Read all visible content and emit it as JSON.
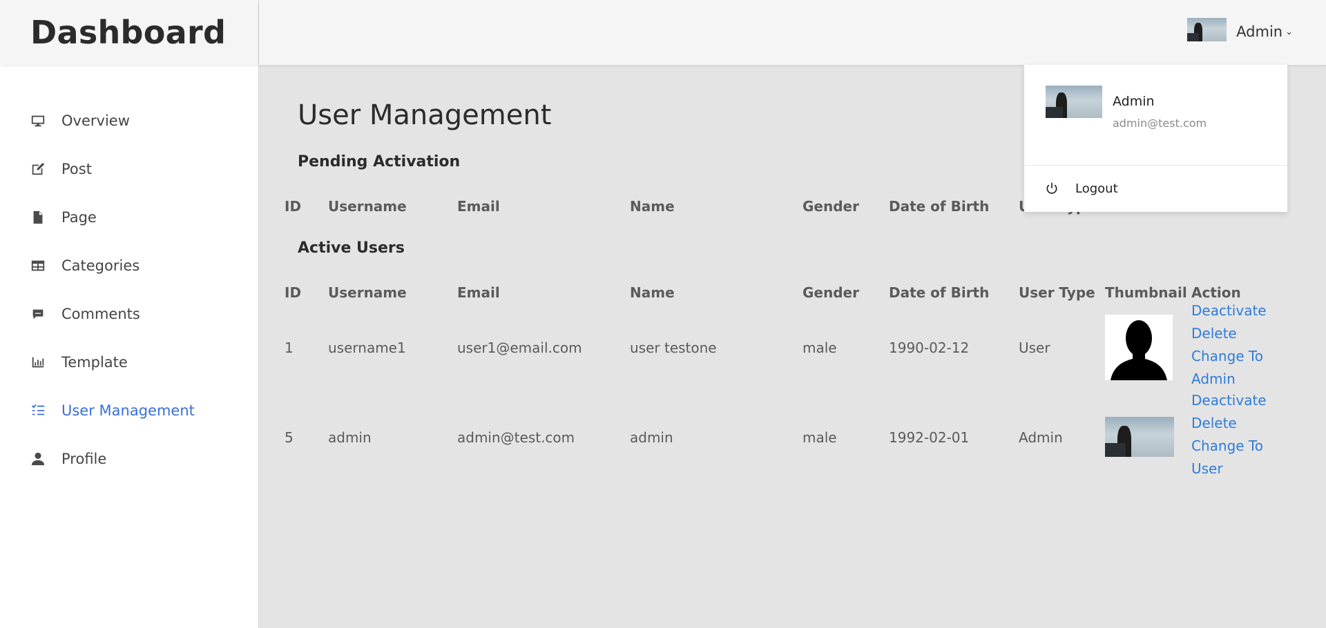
{
  "brand": "Dashboard",
  "sidebar": {
    "items": [
      {
        "label": "Overview",
        "icon": "monitor-icon"
      },
      {
        "label": "Post",
        "icon": "edit-icon"
      },
      {
        "label": "Page",
        "icon": "file-icon"
      },
      {
        "label": "Categories",
        "icon": "table-icon"
      },
      {
        "label": "Comments",
        "icon": "comment-icon"
      },
      {
        "label": "Template",
        "icon": "bar-chart-icon"
      },
      {
        "label": "User Management",
        "icon": "list-check-icon",
        "active": true
      },
      {
        "label": "Profile",
        "icon": "user-icon"
      }
    ]
  },
  "topbar": {
    "user_label": "Admin",
    "caret": "⌄"
  },
  "dropdown": {
    "name": "Admin",
    "email": "admin@test.com",
    "logout": "Logout"
  },
  "main": {
    "title": "User Management",
    "pending": {
      "title": "Pending Activation",
      "headers": [
        "ID",
        "Username",
        "Email",
        "Name",
        "Gender",
        "Date of Birth",
        "User Type"
      ]
    },
    "active": {
      "title": "Active Users",
      "headers": [
        "ID",
        "Username",
        "Email",
        "Name",
        "Gender",
        "Date of Birth",
        "User Type",
        "Thumbnail",
        "Action"
      ],
      "rows": [
        {
          "id": "1",
          "username": "username1",
          "email": "user1@email.com",
          "name": "user testone",
          "gender": "male",
          "dob": "1990-02-12",
          "type": "User",
          "thumbnail": "default-silhouette",
          "actions": [
            "Deactivate",
            "Delete",
            "Change To",
            "Admin"
          ]
        },
        {
          "id": "5",
          "username": "admin",
          "email": "admin@test.com",
          "name": "admin",
          "gender": "male",
          "dob": "1992-02-01",
          "type": "Admin",
          "thumbnail": "photo",
          "actions": [
            "Deactivate",
            "Delete",
            "Change To",
            "User"
          ]
        }
      ]
    }
  },
  "colors": {
    "accent": "#3a6fd8",
    "link": "#2f7cd8",
    "content_bg": "#e4e4e4"
  }
}
